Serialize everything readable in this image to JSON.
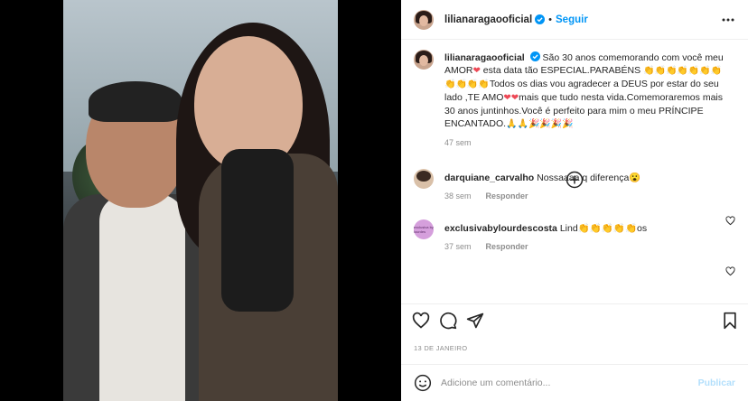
{
  "post": {
    "username": "lilianaragaooficial",
    "follow_label": "Seguir",
    "caption_user": "lilianaragaooficial",
    "caption_part1": "São 30 anos comemorando com você meu AMOR",
    "caption_part2": " esta data tão ESPECIAL.PARABÉNS ",
    "caption_part3": "Todos os dias vou agradecer a DEUS por estar do seu lado ,TE AMO",
    "caption_part4": "mais que tudo nesta vida.Comemoraremos mais 30 anos juntinhos.Você é perfeito para mim o meu PRÍNCIPE ENCANTADO.",
    "caption_emoji_hearts": "❤",
    "caption_emoji_clap": "👏👏👏👏👏👏👏👏👏👏👏",
    "caption_emoji_end": "🙏🙏🎉🎉🎉🎉",
    "caption_time": "47 sem",
    "date": "13 DE JANEIRO"
  },
  "comments": [
    {
      "user": "darquiane_carvalho",
      "text": "Nossaaaa q diferença😮",
      "time": "38 sem",
      "reply": "Responder"
    },
    {
      "user": "exclusivabylourdescosta",
      "text": "Lind👏👏👏👏👏os",
      "time": "37 sem",
      "reply": "Responder"
    }
  ],
  "avatar2_text": "exclusiva by lourdes",
  "add_comment": {
    "placeholder": "Adicione um comentário...",
    "publish_label": "Publicar"
  },
  "colors": {
    "accent": "#0095f6",
    "publish_disabled": "#b2dffc",
    "heart": "#ed4956"
  },
  "icons": [
    "verified-icon",
    "more-icon",
    "add-circle-icon",
    "heart-icon",
    "comment-icon",
    "share-icon",
    "save-icon",
    "smile-icon"
  ]
}
